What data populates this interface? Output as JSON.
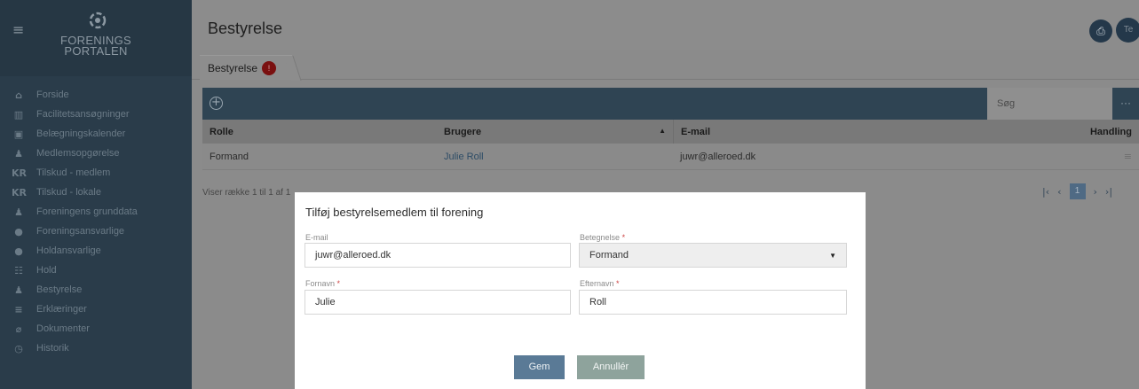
{
  "sidebar": {
    "logo_line1": "FORENINGS",
    "logo_line2": "PORTALEN",
    "items": [
      {
        "icon": "home-icon",
        "glyph": "⌂",
        "label": "Forside"
      },
      {
        "icon": "building-icon",
        "glyph": "▥",
        "label": "Facilitetsansøgninger"
      },
      {
        "icon": "calendar-icon",
        "glyph": "▣",
        "label": "Belægningskalender"
      },
      {
        "icon": "add-user-icon",
        "glyph": "♟",
        "label": "Medlemsopgørelse"
      },
      {
        "icon": "kr-icon",
        "glyph": "KR",
        "label": "Tilskud - medlem"
      },
      {
        "icon": "kr-icon",
        "glyph": "KR",
        "label": "Tilskud - lokale"
      },
      {
        "icon": "group-icon",
        "glyph": "♟",
        "label": "Foreningens grunddata"
      },
      {
        "icon": "user-circle-icon",
        "glyph": "●",
        "label": "Foreningsansvarlige"
      },
      {
        "icon": "user-circle-icon",
        "glyph": "●",
        "label": "Holdansvarlige"
      },
      {
        "icon": "team-icon",
        "glyph": "☷",
        "label": "Hold"
      },
      {
        "icon": "board-icon",
        "glyph": "♟",
        "label": "Bestyrelse"
      },
      {
        "icon": "list-check-icon",
        "glyph": "≡",
        "label": "Erklæringer"
      },
      {
        "icon": "paperclip-icon",
        "glyph": "⌀",
        "label": "Dokumenter"
      },
      {
        "icon": "history-icon",
        "glyph": "◷",
        "label": "Historik"
      }
    ]
  },
  "header": {
    "title": "Bestyrelse",
    "avatar_initials": "Te"
  },
  "tabs": [
    {
      "label": "Bestyrelse",
      "badge": "!"
    }
  ],
  "table": {
    "search_placeholder": "Søg",
    "more_label": "···",
    "columns": [
      "Rolle",
      "Brugere",
      "E-mail",
      "Handling"
    ],
    "rows": [
      {
        "rolle": "Formand",
        "brugere": "Julie Roll",
        "email": "juwr@alleroed.dk"
      }
    ],
    "showing": "Viser række 1 til 1 af 1",
    "current_page": "1"
  },
  "modal": {
    "title": "Tilføj bestyrelsemedlem til forening",
    "email_label": "E-mail",
    "email_value": "juwr@alleroed.dk",
    "betegnelse_label": "Betegnelse",
    "betegnelse_value": "Formand",
    "fornavn_label": "Fornavn",
    "fornavn_value": "Julie",
    "efternavn_label": "Efternavn",
    "efternavn_value": "Roll",
    "required_mark": "*",
    "save_label": "Gem",
    "cancel_label": "Annullér"
  }
}
